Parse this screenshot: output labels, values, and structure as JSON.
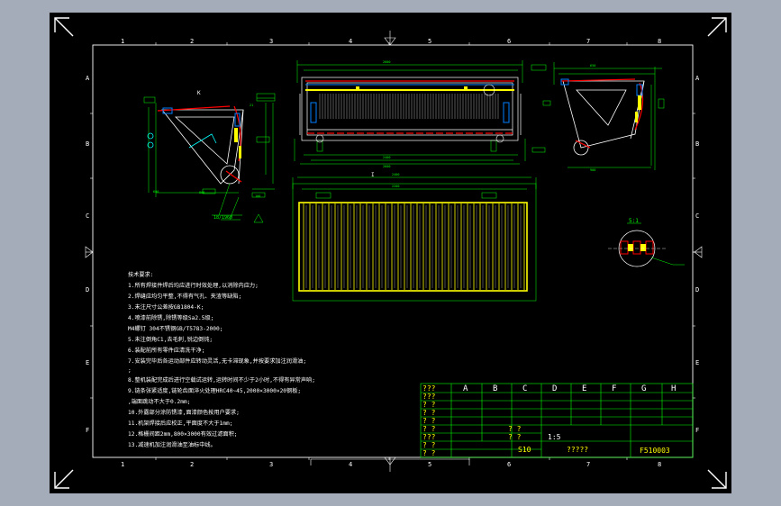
{
  "drawing": {
    "zones_top": [
      "1",
      "2",
      "3",
      "4",
      "5",
      "6",
      "7",
      "8"
    ],
    "zones_bottom": [
      "1",
      "2",
      "3",
      "4",
      "5",
      "6",
      "7",
      "8"
    ],
    "zones_left": [
      "A",
      "B",
      "C",
      "D",
      "E",
      "F"
    ],
    "zones_right": [
      "A",
      "B",
      "C",
      "D",
      "E",
      "F"
    ],
    "detail_label": "I",
    "view_label": "K",
    "section_label": "5:1",
    "part_callout": "18/1960",
    "notes": [
      "技术要求:",
      "1.所有焊接件焊后均应进行时效处理,以消除内应力;",
      "2.焊缝应均匀平整,不得有气孔、夹渣等缺陷;",
      "3.未注尺寸公差按GB1804-K;",
      "4.喷漆前除锈,除锈等级Sa2.5级;",
      "M4螺钉 304不锈钢GB/T5783-2000;",
      "5.未注倒角C1,去毛刺,锐边倒钝;",
      "6.装配前所有零件应清洗干净;",
      "7.安装完毕后各运动部件应转动灵活,无卡滞现象,并按要求加注润滑油;",
      "  ;",
      "8.整机装配完成后进行空载试运转,运转时间不少于2小时,不得有异常声响;",
      "9.链条张紧适度,链轮齿面淬火处理HRC40~45,2000×3000×20钢板;",
      "  ,端面跳动不大于0.2mm;",
      "10.外露部分涂防锈漆,面漆颜色按用户要求;",
      "11.机架焊接后应校正,平面度不大于1mm;",
      "12.格栅间距2mm,800×3000有效过滤面积;",
      "13.减速机加注润滑油至油标中线。"
    ],
    "title_block": {
      "zone_letters": [
        "A",
        "B",
        "C",
        "D",
        "E",
        "F",
        "G",
        "H"
      ],
      "row_labels": [
        "???",
        "???",
        "?  ?",
        "?  ?",
        "?  ?",
        "?  ?",
        "???",
        "?  ?",
        "?  ?"
      ],
      "mid_labels": [
        "?  ?",
        "?  ?"
      ],
      "scale": "1:5",
      "weight_label": "S10",
      "drawing_name": "?????",
      "drawing_number": "F510003"
    }
  }
}
